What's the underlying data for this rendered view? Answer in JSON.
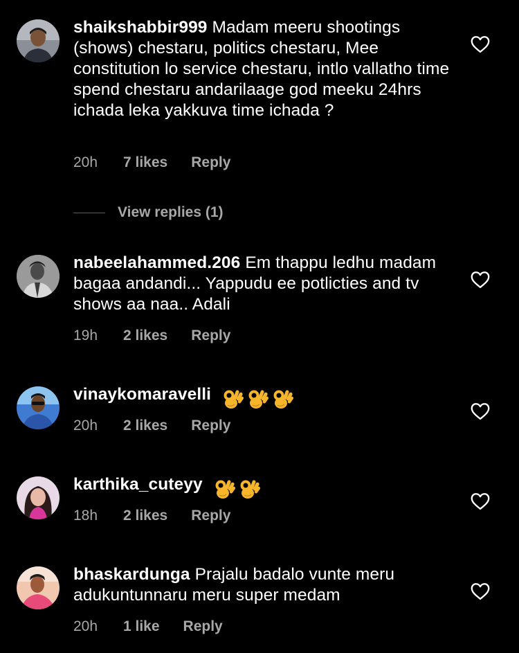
{
  "colors": {
    "background": "#000000",
    "text_primary": "#ffffff",
    "text_secondary": "#a8a8a8"
  },
  "comments": [
    {
      "username": "shaikshabbir999",
      "text": "Madam meeru shootings (shows) chestaru, politics chestaru, Mee constitution lo service chestaru, intlo vallatho time spend chestaru andarilaage god meeku 24hrs ichada leka yakkuva time ichada ?",
      "time": "20h",
      "likes": "7 likes",
      "reply_label": "Reply",
      "like_icon": "heart-outline-icon"
    },
    {
      "username": "nabeelahammed.206",
      "text": "Em thappu ledhu madam bagaa andandi... Yappudu ee potlicties and tv shows aa naa.. Adali",
      "time": "19h",
      "likes": "2 likes",
      "reply_label": "Reply",
      "like_icon": "heart-outline-icon"
    },
    {
      "username": "vinaykomaravelli",
      "text": "",
      "emoji": "ok-hand x3",
      "time": "20h",
      "likes": "2 likes",
      "reply_label": "Reply",
      "like_icon": "heart-outline-icon"
    },
    {
      "username": "karthika_cuteyy",
      "text": "",
      "emoji": "ok-hand x2",
      "time": "18h",
      "likes": "2 likes",
      "reply_label": "Reply",
      "like_icon": "heart-outline-icon"
    },
    {
      "username": "bhaskardunga",
      "text": "Prajalu badalo vunte meru adukuntunnaru meru super medam",
      "time": "20h",
      "likes": "1 like",
      "reply_label": "Reply",
      "like_icon": "heart-outline-icon"
    }
  ],
  "view_replies": "View replies (1)"
}
